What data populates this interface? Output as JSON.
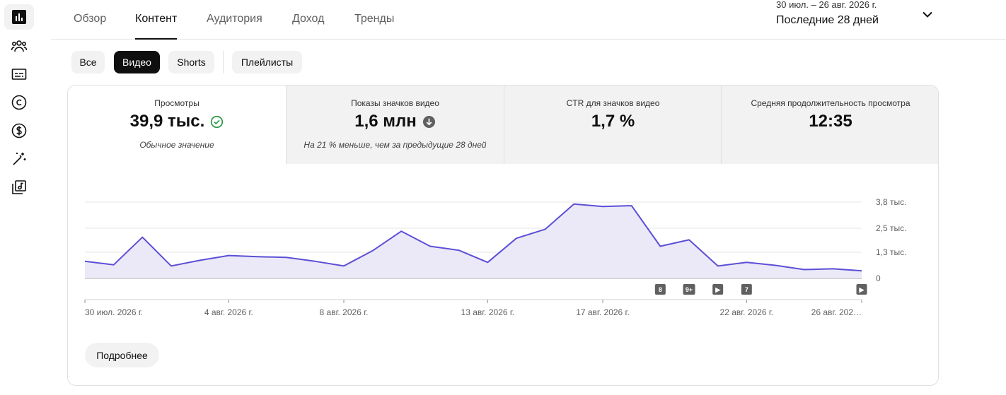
{
  "sidebar": {
    "items": [
      {
        "icon": "analytics-icon",
        "active": true
      },
      {
        "icon": "community-icon",
        "active": false
      },
      {
        "icon": "subtitles-icon",
        "active": false
      },
      {
        "icon": "copyright-icon",
        "active": false
      },
      {
        "icon": "monetization-icon",
        "active": false
      },
      {
        "icon": "customization-icon",
        "active": false
      },
      {
        "icon": "audio-library-icon",
        "active": false
      }
    ]
  },
  "tabs": [
    "Обзор",
    "Контент",
    "Аудитория",
    "Доход",
    "Тренды"
  ],
  "active_tab": "Контент",
  "date_range": {
    "dates": "30 июл. – 26 авг. 2026 г.",
    "period": "Последние 28 дней"
  },
  "chips": [
    "Все",
    "Видео",
    "Shorts",
    "Плейлисты"
  ],
  "active_chip": "Видео",
  "metrics": [
    {
      "label": "Просмотры",
      "value": "39,9 тыс.",
      "status_icon": "check-circle-icon",
      "sub": "Обычное значение",
      "active": true
    },
    {
      "label": "Показы значков видео",
      "value": "1,6 млн",
      "status_icon": "arrow-down-circle-icon",
      "sub": "На 21 % меньше, чем за предыдущие 28 дней",
      "active": false
    },
    {
      "label": "CTR для значков видео",
      "value": "1,7 %",
      "sub": "",
      "active": false
    },
    {
      "label": "Средняя продолжительность просмотра",
      "value": "12:35",
      "sub": "",
      "active": false
    }
  ],
  "chart_data": {
    "type": "area",
    "series": [
      {
        "values": [
          0.85,
          0.68,
          2.05,
          0.62,
          0.9,
          1.14,
          1.08,
          1.05,
          0.85,
          0.62,
          1.38,
          2.35,
          1.6,
          1.4,
          0.8,
          2.0,
          2.45,
          3.7,
          3.58,
          3.62,
          1.6,
          1.92,
          0.62,
          0.8,
          0.65,
          0.44,
          0.48,
          0.38
        ]
      }
    ],
    "colors": {
      "line": "#5c4fd6",
      "fill": "#ebe9f7"
    },
    "ylim": [
      0,
      3.8
    ],
    "y_ticks": [
      {
        "value": 3.8,
        "label": "3,8 тыс."
      },
      {
        "value": 2.5,
        "label": "2,5 тыс."
      },
      {
        "value": 1.3,
        "label": "1,3 тыс."
      },
      {
        "value": 0,
        "label": "0"
      }
    ],
    "x_ticks": [
      {
        "index": 0,
        "label": "30 июл. 2026 г."
      },
      {
        "index": 5,
        "label": "4 авг. 2026 г."
      },
      {
        "index": 9,
        "label": "8 авг. 2026 г."
      },
      {
        "index": 14,
        "label": "13 авг. 2026 г."
      },
      {
        "index": 18,
        "label": "17 авг. 2026 г."
      },
      {
        "index": 23,
        "label": "22 авг. 2026 г."
      },
      {
        "index": 27,
        "label": "26 авг. 202…"
      }
    ],
    "markers": [
      {
        "index": 20,
        "label": "8"
      },
      {
        "index": 21,
        "label": "9+"
      },
      {
        "index": 22,
        "label": "▶"
      },
      {
        "index": 23,
        "label": "7"
      },
      {
        "index": 27,
        "label": "▶"
      }
    ],
    "grid": true,
    "x_start": "2026-07-30",
    "x_end": "2026-08-26",
    "points": 28
  },
  "more_button": "Подробнее"
}
